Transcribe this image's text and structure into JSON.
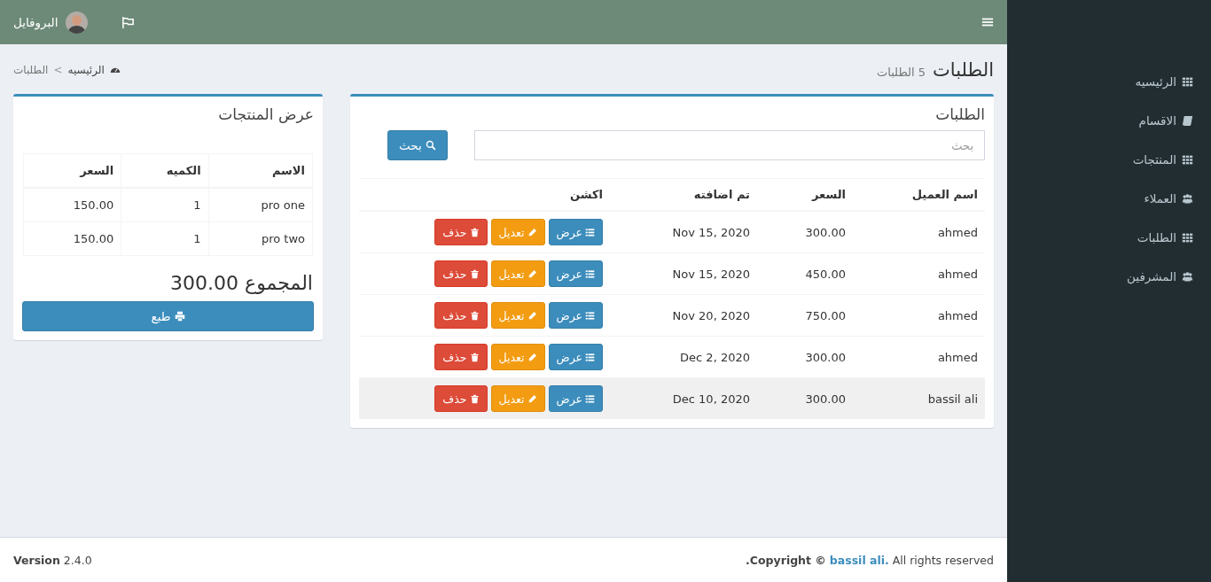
{
  "header": {
    "profile_name": "البروفايل"
  },
  "sidebar": {
    "items": [
      {
        "label": "الرئيسيه",
        "kind": "grid"
      },
      {
        "label": "الاقسام",
        "kind": "book"
      },
      {
        "label": "المنتجات",
        "kind": "grid"
      },
      {
        "label": "العملاء",
        "kind": "users"
      },
      {
        "label": "الطلبات",
        "kind": "grid"
      },
      {
        "label": "المشرفين",
        "kind": "users"
      }
    ]
  },
  "page": {
    "title": "الطلبات",
    "subtitle": "5 الطلبات",
    "breadcrumb_separator": ">",
    "breadcrumb": [
      {
        "label": "الرئيسيه",
        "kind": "home"
      },
      {
        "label": "الطلبات",
        "kind": "current"
      }
    ]
  },
  "orders": {
    "title": "الطلبات",
    "search": {
      "placeholder": "بحث",
      "button": "بحث"
    },
    "columns": [
      "اسم العميل",
      "السعر",
      "تم اضافته",
      "اكشن"
    ],
    "rows": [
      {
        "customer": "ahmed",
        "price": "300.00",
        "added": "Nov 15, 2020",
        "highlighted": false,
        "actions": [
          {
            "label": "عرض",
            "kind": "view"
          },
          {
            "label": "تعديل",
            "kind": "edit"
          },
          {
            "label": "حذف",
            "kind": "delete"
          }
        ]
      },
      {
        "customer": "ahmed",
        "price": "450.00",
        "added": "Nov 15, 2020",
        "highlighted": false,
        "actions": [
          {
            "label": "عرض",
            "kind": "view"
          },
          {
            "label": "تعديل",
            "kind": "edit"
          },
          {
            "label": "حذف",
            "kind": "delete"
          }
        ]
      },
      {
        "customer": "ahmed",
        "price": "750.00",
        "added": "Nov 20, 2020",
        "highlighted": false,
        "actions": [
          {
            "label": "عرض",
            "kind": "view"
          },
          {
            "label": "تعديل",
            "kind": "edit"
          },
          {
            "label": "حذف",
            "kind": "delete"
          }
        ]
      },
      {
        "customer": "ahmed",
        "price": "300.00",
        "added": "Dec 2, 2020",
        "highlighted": false,
        "actions": [
          {
            "label": "عرض",
            "kind": "view"
          },
          {
            "label": "تعديل",
            "kind": "edit"
          },
          {
            "label": "حذف",
            "kind": "delete"
          }
        ]
      },
      {
        "customer": "bassil ali",
        "price": "300.00",
        "added": "Dec 10, 2020",
        "highlighted": true,
        "actions": [
          {
            "label": "عرض",
            "kind": "view"
          },
          {
            "label": "تعديل",
            "kind": "edit"
          },
          {
            "label": "حذف",
            "kind": "delete"
          }
        ]
      }
    ]
  },
  "products": {
    "title": "عرض المنتجات",
    "columns": [
      "الاسم",
      "الكميه",
      "السعر"
    ],
    "rows": [
      [
        "pro one",
        "1",
        "150.00"
      ],
      [
        "pro two",
        "1",
        "150.00"
      ]
    ],
    "total": "المجموع 300.00",
    "print_button": "طبع"
  },
  "footer": {
    "version": "**Version** 2.4.0",
    "copyright": ".Copyright ©",
    "author": "bassil ali.",
    "rights": "All rights reserved"
  }
}
